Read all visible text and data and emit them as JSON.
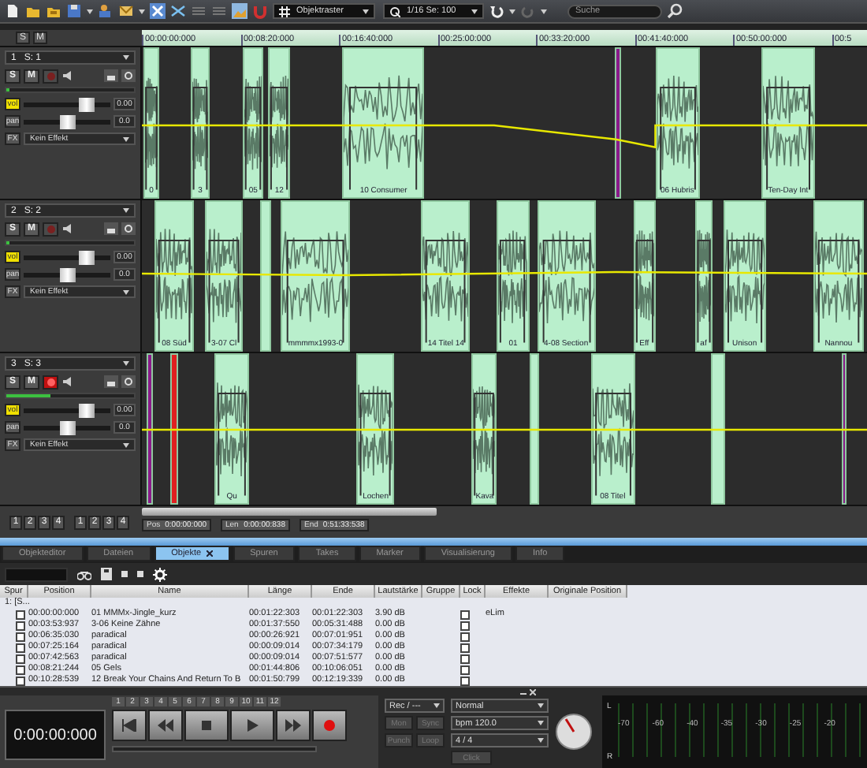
{
  "toolbar": {
    "snap_mode": "Objektraster",
    "quantize": "1/16 Se: 100",
    "search": {
      "placeholder": "Suche"
    }
  },
  "ruler": {
    "header_buttons": [
      "S",
      "M"
    ],
    "ticks": [
      "00:00:00:000",
      "00:08:20:000",
      "00:16:40:000",
      "00:25:00:000",
      "00:33:20:000",
      "00:41:40:000",
      "00:50:00:000",
      "00:5"
    ]
  },
  "tracks": [
    {
      "number": "1",
      "name": "S: 1",
      "solo_label": "S",
      "solo": false,
      "mute_label": "M",
      "mute": false,
      "record": false,
      "level": 0,
      "volume": {
        "label": "vol",
        "value": "0.00",
        "level": 0.72
      },
      "pan": {
        "label": "pan",
        "value": "0.0",
        "level": 0.5
      },
      "fx_label": "FX",
      "fx": "Kein Effekt",
      "clips": [
        {
          "label": "0",
          "color": "#b9efcc"
        },
        {
          "label": "3",
          "color": "#b9efcc"
        },
        {
          "label": "05",
          "color": "#b9efcc"
        },
        {
          "label": "12",
          "color": "#b9efcc"
        },
        {
          "label": "10 Consumer",
          "color": "#b9efcc"
        },
        {
          "color": "#8a1a8a"
        },
        {
          "label": "06 Hubris",
          "color": "#b9efcc"
        },
        {
          "label": "Ten-Day Int",
          "color": "#b9efcc"
        }
      ]
    },
    {
      "number": "2",
      "name": "S: 2",
      "solo_label": "S",
      "solo": false,
      "mute_label": "M",
      "mute": false,
      "record": false,
      "level": 0,
      "volume": {
        "label": "vol",
        "value": "0.00",
        "level": 0.72
      },
      "pan": {
        "label": "pan",
        "value": "0.0",
        "level": 0.5
      },
      "fx_label": "FX",
      "fx": "Kein Effekt",
      "clips": [
        {
          "label": "08 Süd",
          "color": "#b9efcc"
        },
        {
          "label": "3-07 Cl",
          "color": "#b9efcc"
        },
        {
          "color": "#b9efcc"
        },
        {
          "label": "mmmmx1993-0",
          "color": "#b9efcc"
        },
        {
          "label": "14 Titel 14",
          "color": "#b9efcc"
        },
        {
          "label": "01",
          "color": "#b9efcc"
        },
        {
          "label": "4-08 Section",
          "color": "#b9efcc"
        },
        {
          "label": "Eff",
          "color": "#b9efcc"
        },
        {
          "label": "af",
          "color": "#b9efcc"
        },
        {
          "label": "Unison",
          "color": "#b9efcc"
        },
        {
          "label": "Nannou",
          "color": "#b9efcc"
        }
      ]
    },
    {
      "number": "3",
      "name": "S: 3",
      "solo_label": "S",
      "solo": false,
      "mute_label": "M",
      "mute": false,
      "record": true,
      "level": 0.35,
      "volume": {
        "label": "vol",
        "value": "0.00",
        "level": 0.72
      },
      "pan": {
        "label": "pan",
        "value": "0.0",
        "level": 0.5
      },
      "fx_label": "FX",
      "fx": "Kein Effekt",
      "clips": [
        {
          "color": "#8a1a8a"
        },
        {
          "color": "#e02020"
        },
        {
          "label": "Qu",
          "color": "#b9efcc"
        },
        {
          "label": "Lochen",
          "color": "#b9efcc"
        },
        {
          "label": "Kava",
          "color": "#b9efcc"
        },
        {
          "color": "#b9efcc"
        },
        {
          "label": "08 Titel",
          "color": "#b9efcc"
        },
        {
          "color": "#b9efcc"
        },
        {
          "color": "#8a1a8a"
        }
      ]
    }
  ],
  "group_buttons": [
    [
      "1",
      "2",
      "3",
      "4"
    ],
    [
      "1",
      "2",
      "3",
      "4"
    ]
  ],
  "position_bar": [
    {
      "label": "Pos",
      "value": "0:00:00:000"
    },
    {
      "label": "Len",
      "value": "0:00:00:838"
    },
    {
      "label": "End",
      "value": "0:51:33:538"
    }
  ],
  "panel": {
    "tabs": [
      {
        "label": "Objekteditor",
        "selected": false
      },
      {
        "label": "Dateien",
        "selected": false
      },
      {
        "label": "Objekte",
        "selected": true
      },
      {
        "label": "Spuren",
        "selected": false
      },
      {
        "label": "Takes",
        "selected": false
      },
      {
        "label": "Marker",
        "selected": false
      },
      {
        "label": "Visualisierung",
        "selected": false
      },
      {
        "label": "Info",
        "selected": false
      }
    ],
    "columns": [
      "Spur",
      "Position",
      "Name",
      "Länge",
      "Ende",
      "Lautstärke",
      "Gruppe",
      "Lock",
      "Effekte",
      "Originale Position"
    ],
    "root": "1: [S...",
    "rows": [
      {
        "checked": false,
        "position": "00:00:00:000",
        "name": "01 MMMx-Jingle_kurz",
        "length": "00:01:22:303",
        "end": "00:01:22:303",
        "volume": "3.90 dB",
        "lock": false,
        "effects": "eLim"
      },
      {
        "checked": false,
        "position": "00:03:53:937",
        "name": "3-06 Keine Zähne",
        "length": "00:01:37:550",
        "end": "00:05:31:488",
        "volume": "0.00 dB",
        "lock": false
      },
      {
        "checked": false,
        "position": "00:06:35:030",
        "name": "paradical",
        "length": "00:00:26:921",
        "end": "00:07:01:951",
        "volume": "0.00 dB",
        "lock": false
      },
      {
        "checked": false,
        "position": "00:07:25:164",
        "name": "paradical",
        "length": "00:00:09:014",
        "end": "00:07:34:179",
        "volume": "0.00 dB",
        "lock": false
      },
      {
        "checked": false,
        "position": "00:07:42:563",
        "name": "paradical",
        "length": "00:00:09:014",
        "end": "00:07:51:577",
        "volume": "0.00 dB",
        "lock": false
      },
      {
        "checked": false,
        "position": "00:08:21:244",
        "name": "05 Gels",
        "length": "00:01:44:806",
        "end": "00:10:06:051",
        "volume": "0.00 dB",
        "lock": false
      },
      {
        "checked": false,
        "position": "00:10:28:539",
        "name": "12 Break Your Chains And Return To B",
        "length": "00:01:50:799",
        "end": "00:12:19:339",
        "volume": "0.00 dB",
        "lock": false
      }
    ]
  },
  "transport": {
    "markers": [
      "1",
      "2",
      "3",
      "4",
      "5",
      "6",
      "7",
      "8",
      "9",
      "10",
      "11",
      "12"
    ],
    "time": "0:00:00:000",
    "record_mode": "Rec / ---",
    "options": [
      {
        "label": "Mon",
        "disabled": true
      },
      {
        "label": "Sync",
        "disabled": true
      },
      {
        "label": "Punch",
        "disabled": true
      },
      {
        "label": "Loop",
        "disabled": true
      }
    ],
    "play_mode": "Normal",
    "bpm": "bpm 120.0",
    "signature": "4 / 4",
    "click": {
      "label": "Click",
      "disabled": true
    },
    "scale": [
      "-70",
      "-60",
      "-40",
      "-35",
      "-30",
      "-25",
      "-20"
    ],
    "channels": [
      "L",
      "R"
    ]
  }
}
